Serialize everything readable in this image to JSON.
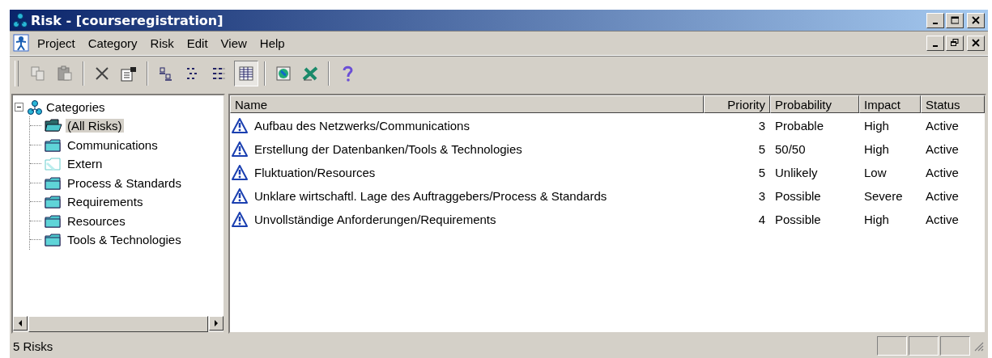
{
  "window": {
    "title": "Risk - [courseregistration]"
  },
  "menu": [
    {
      "label": "Project"
    },
    {
      "label": "Category"
    },
    {
      "label": "Risk"
    },
    {
      "label": "Edit"
    },
    {
      "label": "View"
    },
    {
      "label": "Help"
    }
  ],
  "toolbar": [
    [
      {
        "disabled": true,
        "pressed": false
      },
      {
        "disabled": true,
        "pressed": false
      }
    ],
    [
      {
        "disabled": false,
        "pressed": false
      },
      {
        "disabled": false,
        "pressed": false
      }
    ],
    [
      {
        "disabled": false,
        "pressed": false
      },
      {
        "disabled": false,
        "pressed": false
      },
      {
        "disabled": false,
        "pressed": false
      },
      {
        "disabled": false,
        "pressed": true
      }
    ],
    [
      {
        "disabled": false,
        "pressed": false
      },
      {
        "disabled": false,
        "pressed": false
      }
    ],
    [
      {
        "disabled": false,
        "pressed": false
      }
    ]
  ],
  "tree": {
    "label": "Categories",
    "expanded": true,
    "children": [
      {
        "label": "(All Risks)",
        "kind": "open",
        "selected": true
      },
      {
        "label": "Communications",
        "kind": "folder",
        "selected": false
      },
      {
        "label": "Extern",
        "kind": "empty",
        "selected": false
      },
      {
        "label": "Process & Standards",
        "kind": "folder",
        "selected": false
      },
      {
        "label": "Requirements",
        "kind": "folder",
        "selected": false
      },
      {
        "label": "Resources",
        "kind": "folder",
        "selected": false
      },
      {
        "label": "Tools & Technologies",
        "kind": "folder",
        "selected": false
      }
    ]
  },
  "table": {
    "columns": [
      "Name",
      "Priority",
      "Probability",
      "Impact",
      "Status"
    ],
    "rows": [
      [
        "Aufbau des Netzwerks/Communications",
        "3",
        "Probable",
        "High",
        "Active"
      ],
      [
        "Erstellung der Datenbanken/Tools & Technologies",
        "5",
        "50/50",
        "High",
        "Active"
      ],
      [
        "Fluktuation/Resources",
        "5",
        "Unlikely",
        "Low",
        "Active"
      ],
      [
        "Unklare wirtschaftl. Lage des Auftraggebers/Process & Standards",
        "3",
        "Possible",
        "Severe",
        "Active"
      ],
      [
        "Unvollständige Anforderungen/Requirements",
        "4",
        "Possible",
        "High",
        "Active"
      ]
    ]
  },
  "status_bar": {
    "text": "5 Risks"
  }
}
